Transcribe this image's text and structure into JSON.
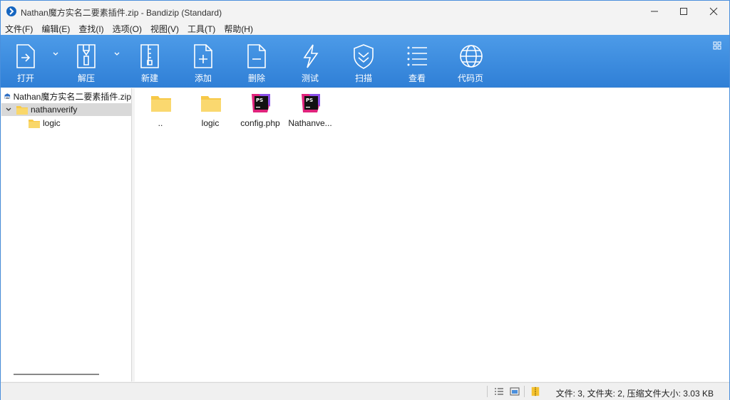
{
  "window": {
    "title": "Nathan魔方实名二要素插件.zip - Bandizip (Standard)",
    "minimize_icon": "minimize-icon",
    "maximize_icon": "maximize-icon",
    "close_icon": "close-icon"
  },
  "menu": [
    {
      "label": "文件(F)"
    },
    {
      "label": "编辑(E)"
    },
    {
      "label": "查找(I)"
    },
    {
      "label": "选项(O)"
    },
    {
      "label": "视图(V)"
    },
    {
      "label": "工具(T)"
    },
    {
      "label": "帮助(H)"
    }
  ],
  "toolbar": {
    "buttons": [
      {
        "label": "打开",
        "icon": "open-icon"
      },
      {
        "label": "解压",
        "icon": "extract-icon"
      },
      {
        "label": "新建",
        "icon": "new-archive-icon"
      },
      {
        "label": "添加",
        "icon": "add-file-icon"
      },
      {
        "label": "删除",
        "icon": "delete-file-icon"
      },
      {
        "label": "测试",
        "icon": "test-icon"
      },
      {
        "label": "扫描",
        "icon": "scan-shield-icon"
      },
      {
        "label": "查看",
        "icon": "view-list-icon"
      },
      {
        "label": "代码页",
        "icon": "codepage-globe-icon"
      }
    ]
  },
  "tree": {
    "root": "Nathan魔方实名二要素插件.zip",
    "items": [
      {
        "label": "nathanverify",
        "expanded": true,
        "selected": true
      },
      {
        "label": "logic"
      }
    ]
  },
  "files": [
    {
      "name": "..",
      "type": "folder"
    },
    {
      "name": "logic",
      "type": "folder"
    },
    {
      "name": "config.php",
      "type": "phpstorm"
    },
    {
      "name": "Nathanve...",
      "type": "phpstorm"
    }
  ],
  "file_icon_text": "PS",
  "status": {
    "text": "文件: 3, 文件夹: 2, 压缩文件大小: 3.03 KB"
  },
  "colors": {
    "toolbar": "#3a8ae0",
    "folder": "#f7c948",
    "ps_badge": "#e0237c"
  }
}
